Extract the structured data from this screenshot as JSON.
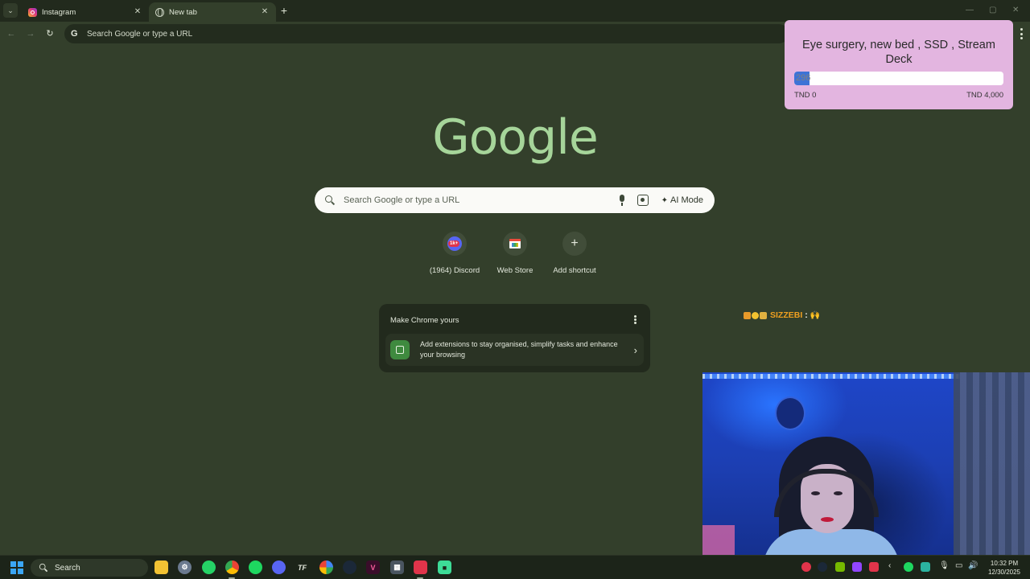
{
  "browser": {
    "tabs": [
      {
        "title": "Instagram",
        "active": false,
        "favicon": "instagram-icon"
      },
      {
        "title": "New tab",
        "active": true,
        "favicon": "globe-icon"
      }
    ],
    "omnibox_placeholder": "Search Google or type a URL"
  },
  "ntp": {
    "logo": "Google",
    "search_placeholder": "Search Google or type a URL",
    "ai_mode_label": "AI Mode",
    "shortcuts": [
      {
        "label": "(1964) Discord",
        "icon": "discord-icon",
        "badge": "1k+"
      },
      {
        "label": "Web Store",
        "icon": "web-store-icon"
      },
      {
        "label": "Add shortcut",
        "icon": "plus-icon"
      }
    ],
    "card": {
      "title": "Make Chrome yours",
      "item_text": "Add extensions to stay organised, simplify tasks and enhance your browsing"
    }
  },
  "overlay": {
    "goal": {
      "title": "Eye surgery, new bed , SSD , Stream Deck",
      "current_value": "296",
      "progress_fraction": 0.074,
      "min_label": "TND 0",
      "max_label": "TND 4,000",
      "background_color": "#e3b5e0",
      "fill_color": "#3d73d6"
    },
    "chat": {
      "username": "SIZZEBI",
      "separator": ":",
      "message": "🙌",
      "name_color": "#f0a020"
    }
  },
  "taskbar": {
    "search_label": "Search",
    "apps": [
      "file-explorer-icon",
      "settings-icon",
      "whatsapp-icon",
      "chrome-icon",
      "spotify-icon",
      "discord-icon",
      "tf-icon",
      "chrome-icon",
      "steam-icon",
      "app-icon",
      "calculator-icon",
      "paint-icon",
      "terminal-icon"
    ],
    "clock": {
      "time": "10:32 PM",
      "date": "12/30/2025"
    }
  }
}
